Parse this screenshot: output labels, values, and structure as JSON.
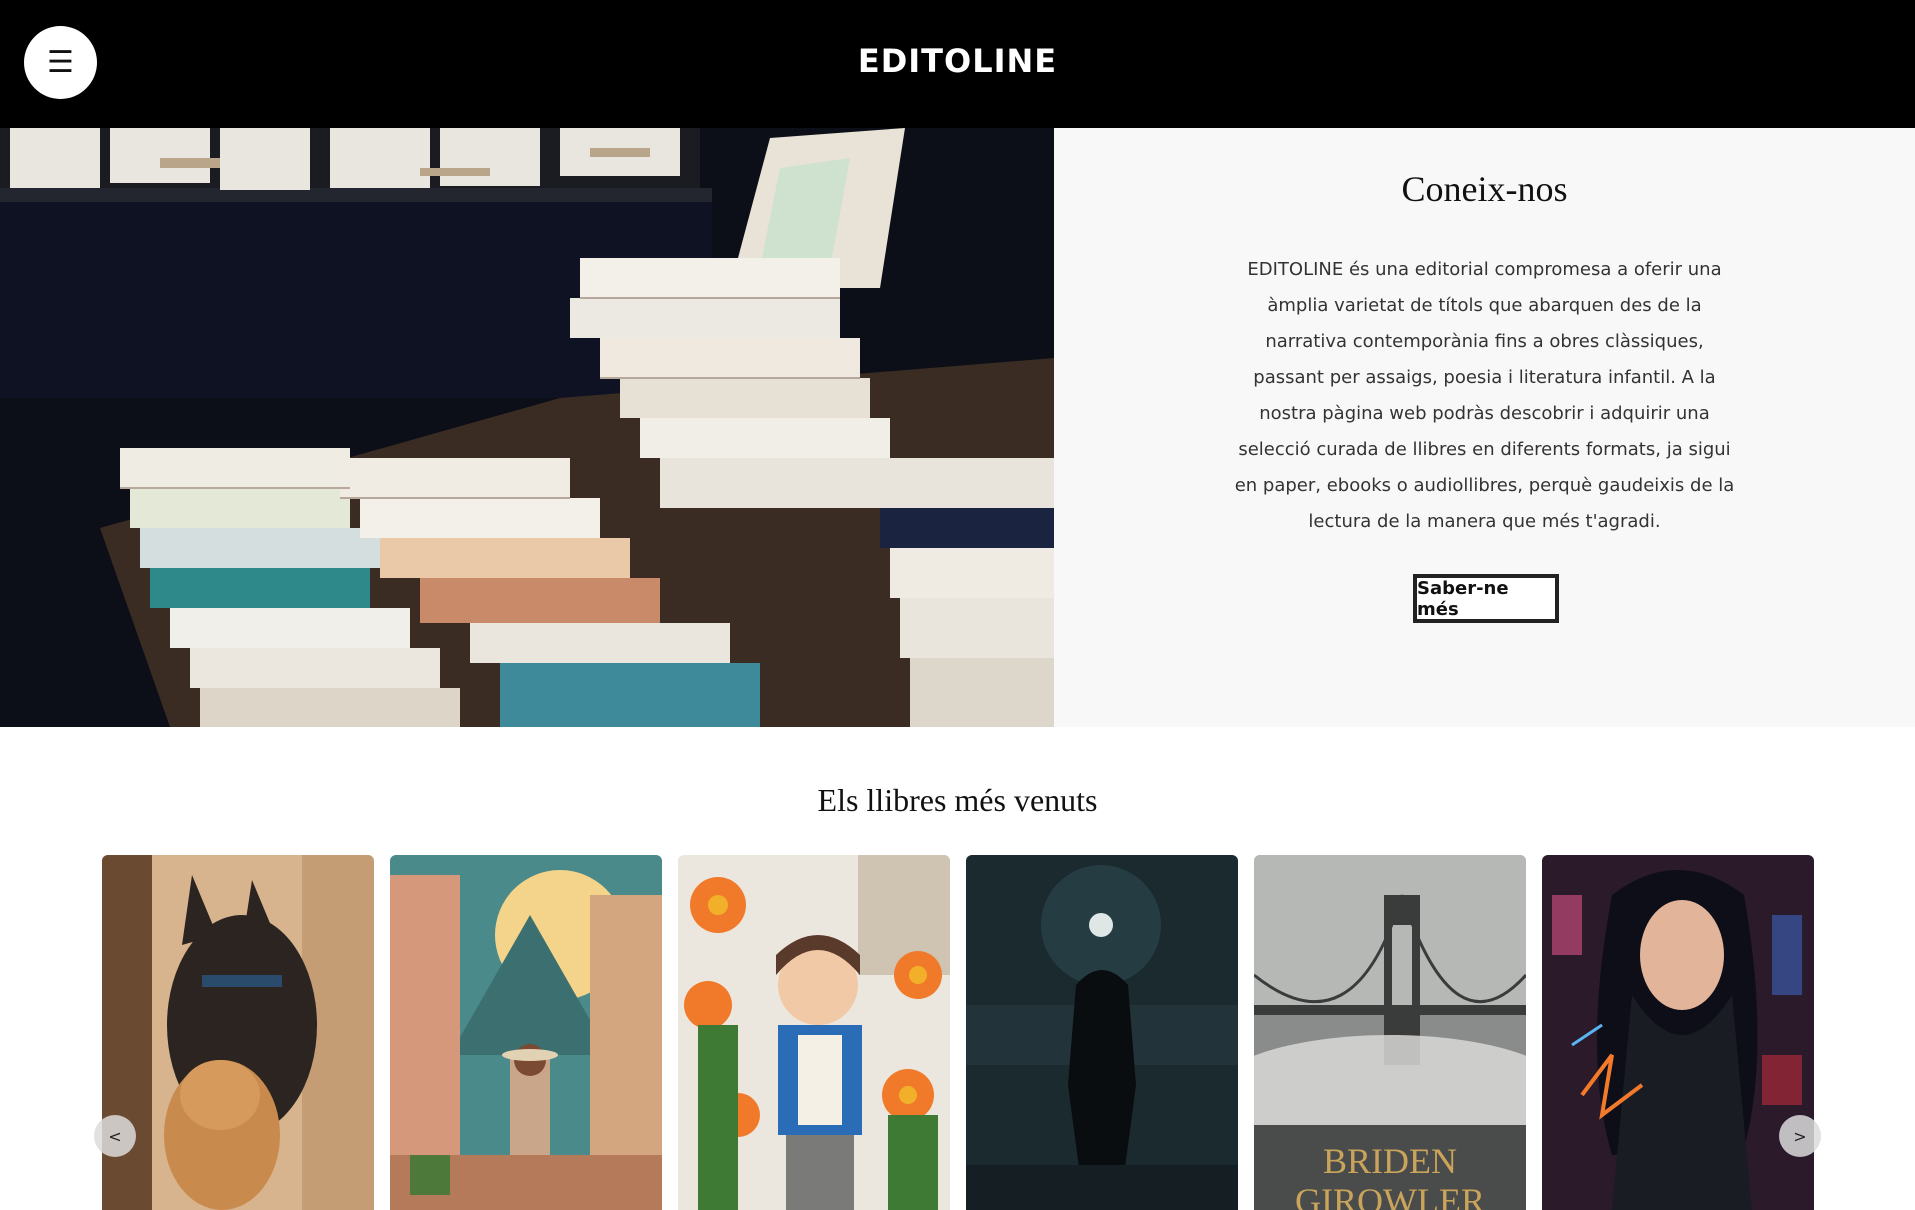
{
  "header": {
    "menu_icon": "☰",
    "site_title": "EDITOLINE"
  },
  "hero": {
    "heading": "Coneix-nos",
    "text": "EDITOLINE és una editorial compromesa a oferir una àmplia varietat de títols que abarquen des de la narrativa contemporània fins a obres clàssiques, passant per assaigs, poesia i literatura infantil. A la nostra pàgina web podràs descobrir i adquirir una selecció curada de llibres en diferents formats, ja sigui en paper, ebooks o audiollibres, perquè gaudeixis de la lectura de la manera que més t'agradi.",
    "button_label": "Saber-ne més"
  },
  "bestsellers": {
    "title": "Els llibres més venuts",
    "prev_label": "<",
    "next_label": ">",
    "books": [
      {
        "subject": "dogs"
      },
      {
        "subject": "adventurer-in-street"
      },
      {
        "subject": "boy-with-flowers"
      },
      {
        "subject": "figure-under-moon"
      },
      {
        "subject": "bridge-in-fog",
        "cover_text_1": "BRIDEN",
        "cover_text_2": "GIROWLER"
      },
      {
        "subject": "cyber-heroine"
      }
    ]
  },
  "colors": {
    "header_bg": "#000000",
    "panel_bg": "#f8f8f8",
    "cover_gold": "#c9a45a"
  }
}
